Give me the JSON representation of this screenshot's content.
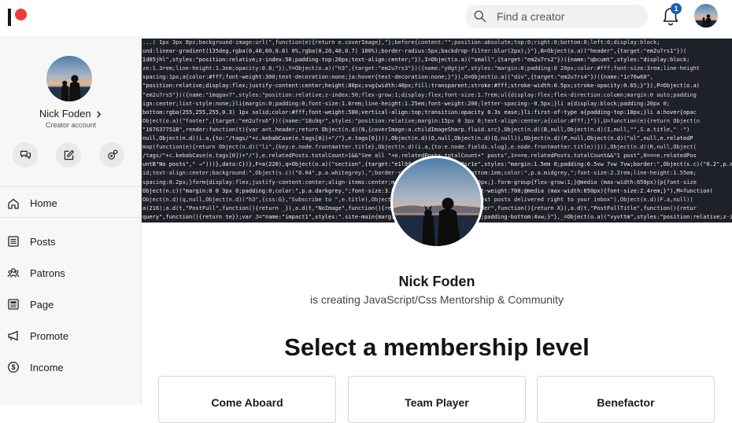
{
  "search": {
    "placeholder": "Find a creator"
  },
  "notifications": {
    "count": "1"
  },
  "sidebar": {
    "name": "Nick Foden",
    "role": "Creator account",
    "quick_actions": [
      "messages-icon",
      "compose-icon",
      "settings-icon"
    ],
    "nav": [
      {
        "label": "Home",
        "icon": "home-icon"
      },
      {
        "label": "Posts",
        "icon": "posts-icon"
      },
      {
        "label": "Patrons",
        "icon": "patrons-icon"
      },
      {
        "label": "Page",
        "icon": "page-icon"
      },
      {
        "label": "Promote",
        "icon": "megaphone-icon"
      },
      {
        "label": "Income",
        "icon": "dollar-icon"
      }
    ]
  },
  "cover": {
    "code_lines": [
      "...) 1px 3px 8px;background-image:url(\",function(e){return e.coverImage},\"};before{content:\"\";position:absolute;top:0;right:0;bottom:0;left:0;display:block;",
      "und:linear-gradient(135deg,rgba(0,40,60,0.8) 0%,rgba(0,20,40,0.7) 100%);border-radius:5px;backdrop-filter:blur(2px);}\"},B=Object(o.a)(\"header\",{target:\"em2u7rs1\"})(",
      "Id05jhl\",styles:\"position:relative;z-index:50;padding-top:20px;text-align:center;\"}),I=Object(o.a)(\"small\",{target:\"em2u7rs2\"})({name:\"qbcumt\",styles:\"display:block;",
      "ze:1.3rem;line-height:1.3em;opacity:0.8;\"}),Y=Object(o.a)(\"h3\",{target:\"em2u7rs3\"})({name:\"y0gtje\",styles:\"margin:0;padding:0 20px;color:#fff;font-size:3rem;line-height",
      "spacing:1px;a{color:#fff;font-weight:300;text-decoration:none;}a:hover{text-decoration:none;}\"}),O=Object(o.a)(\"div\",{target:\"em2u7rs4\"})({name:\"1r76w68\",",
      "\"position:relative;display:flex;justify-content:center;height:80px;svg{width:40px;fill:transparent;stroke:#fff;stroke-width:0.5px;stroke-opacity:0.65;}\"}),P=Object(o.a)",
      "\"em2u7rs5\"})({name:\"1mqgav7\",styles:\"position:relative;z-index:50;flex-grow:1;display:flex;font-size:1.7rem;ul{display:flex;flex-direction:column;margin:0 auto;padding",
      "ign:center;list-style:none;}li{margin:0;padding:0;font-size:1.6rem;line-height:1.25em;font-weight:200;letter-spacing:-0.5px;}li a{display:block;padding:20px 0;",
      "bottom:rgba(255,255,255,0.3) 1px solid;color:#fff;font-weight:500;vertical-align:top;transition:opacity 0.3s ease;}li:first-of-type a{padding-top:10px;}li a:hover{opac",
      "Object(o.a)(\"footer\",{target:\"em2u7rs6\"})({name:\"18u9qr\",styles:\"position:relative;margin:15px 0 3px 0;text-align:center;a{color:#fff;}\"}),U=function(e){return Object(n",
      "\"167637751B\",render:function(t){var a=t.header;return Object(n.d)(N,{coverImage:a.childImageSharp.fluid.src},Object(n.d)(B,null,Object(n.d)(I,null,\"\",S.a.title,\" -\")",
      "null,Object(n.d)(i.a,{to:\"/tags/\"+c.kebabCase(e.tags[0])+\"/\"},e.tags[0]))),Object(n.d)(O,null,Object(n.d)(Q,null)),Object(n.d)(P,null,Object(n.d)(\"ul\",null,e.relatedP",
      "map(function(e){return Object(n.d)(\"li\",{key:e.node.frontmatter.title},Object(n.d)(i.a,{to:e.node.fields.slug},e.node.frontmatter.title))})),Object(n.d)(R,null,Object(",
      "/tags/\"+c.kebabCase(e.tags[0])+\"/\"},e.relatedPosts.totalCount>1&&\"See all \"+e.relatedPosts.totalCount+\" posts\",1===e.relatedPosts.totalCount&&\"1 post\",0===e.relatedPos",
      "untB\"No posts\",\" →\")))},data:C})},F=a(220),q=Object(o.a)(\"section\",{target:\"e1l9fp0\"})({name:\"1s8sr1e\",styles:\"margin:1.5em 0;padding:6.5vw 7vw 7vw;border:\",Object(s.c)(\"0.2\",p.a.whitegr",
      "id;text-align:center;background:\",Object(s.c)(\"0.04\",p.a.whitegrey),\";border-radius:7px;h3{margin-bottom:1em;color:\",p.a.midgrey,\";font-size:2.2rem;line-height:1.55em;",
      "spacing:0.2px;}form{display:flex;justify-content:center;align-items:center;margin:0 auto;max-width:420px;}.form-group{flex-grow:1;}@media (max-width:650px){p{font-size",
      "Object(n.c)(\"margin:0 0 3px 0;padding:0;color:\",p.a.darkgrey,\";font-size:3.5rem;line-height:1.15em;font-weight:700;@media (max-width:650px){font-size:2.4rem;}\"),M=function(",
      " Object(n.d)(q,null,Object(n.d)(\"h3\",{css:G},\"Subscribe to \",e.title),Object(n.d)(\"p\",null,\"Get the latest posts delivered right to your inbox\"),Object(n.d)(F.a,null))",
      "a(216);a.d(t,\"PostFull\",function(){return _}),a.d(t,\"NoImage\",function(){return Z}),a.d(t,\"PostFullHeader\",function(){return X}),a.d(t,\"PostFullTitle\",function(){retur",
      "query\",function(){return te});var J=\"name:\"impact1\",styles:\".site-main{margin-top:64px;background:#fff;padding-bottom:4vw;}\"},_=Object(o.a)(\"vyvttm\",styles:\"position:relative;z-index:50;\"}"
    ]
  },
  "profile": {
    "name": "Nick Foden",
    "tagline": "is creating JavaScript/Css Mentorship & Community"
  },
  "membership": {
    "title": "Select a membership level",
    "tiers": [
      "Come Aboard",
      "Team Player",
      "Benefactor"
    ]
  },
  "colors": {
    "brand": "#ee3a3a",
    "notification_badge": "#1d5fb8",
    "cover_background": "#1e2128"
  }
}
